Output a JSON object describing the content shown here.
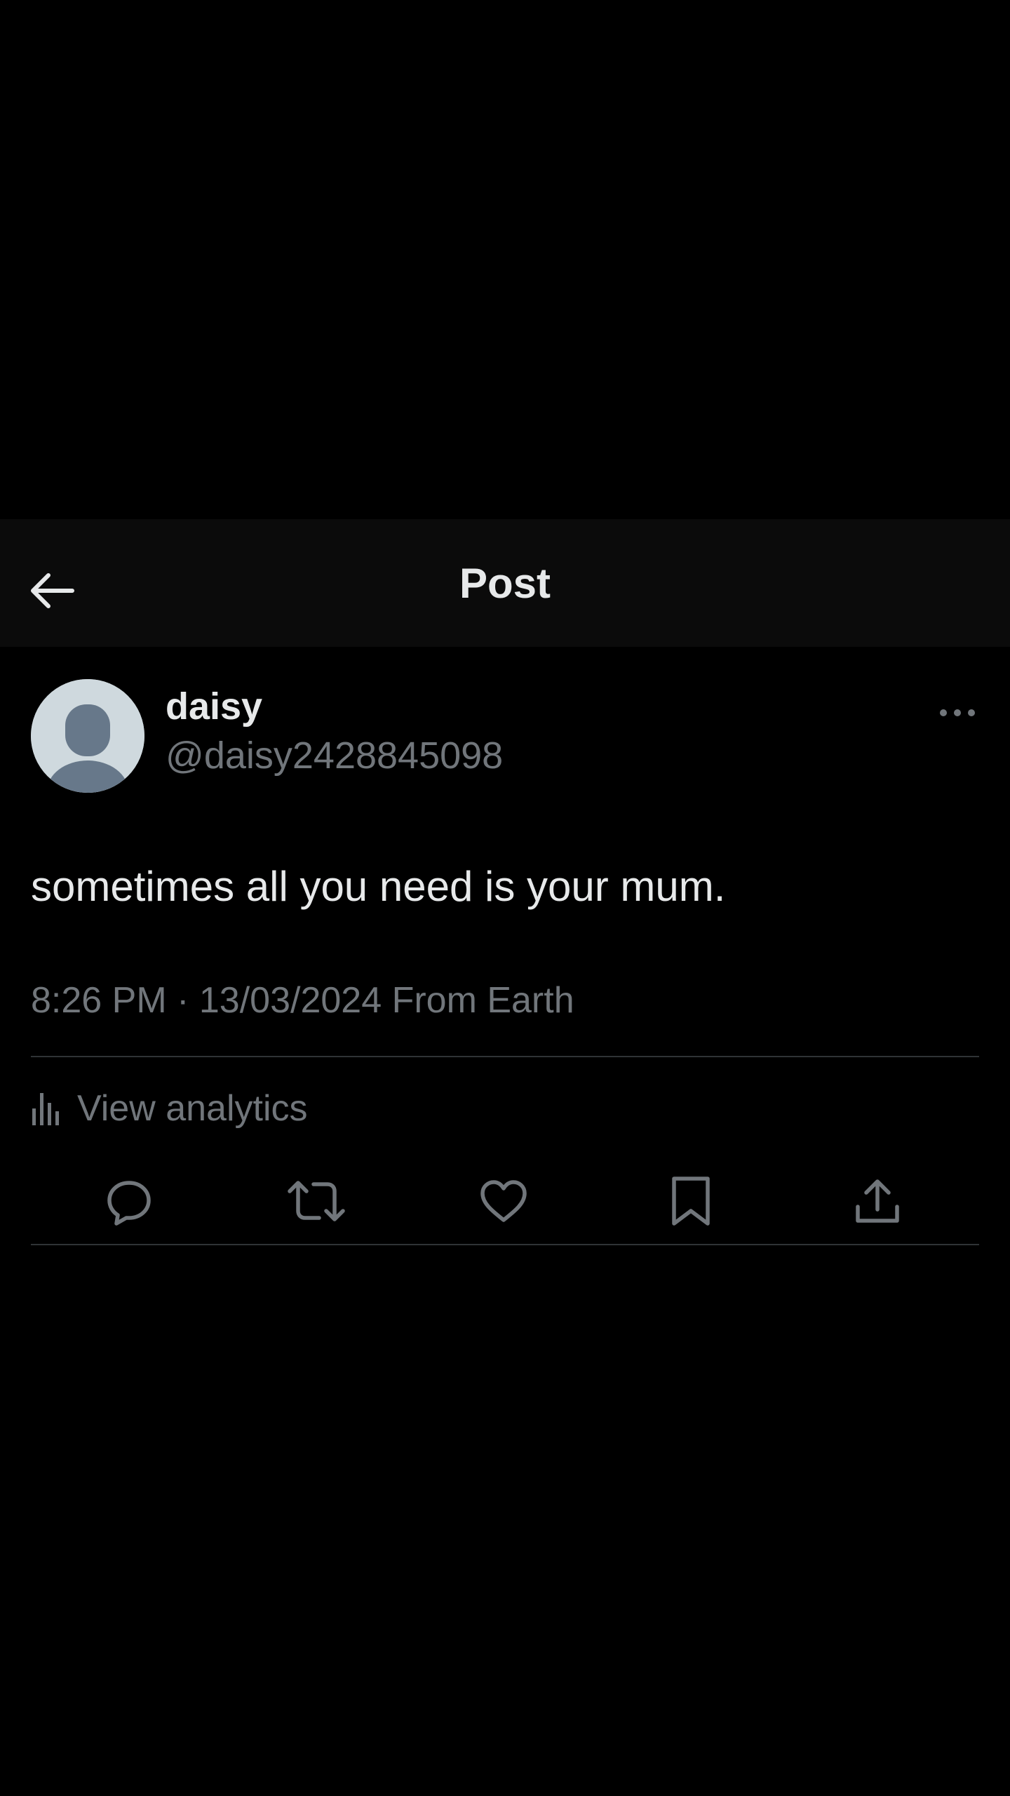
{
  "header": {
    "title": "Post",
    "back_icon": "arrow-left-icon"
  },
  "post": {
    "author": {
      "display_name": "daisy",
      "handle": "@daisy2428845098",
      "avatar": "default-avatar-icon"
    },
    "more_icon": "more-horizontal-icon",
    "text": "sometimes all you need is your mum.",
    "meta": "8:26 PM · 13/03/2024 From Earth",
    "analytics": {
      "label": "View analytics",
      "icon": "analytics-icon"
    },
    "actions": [
      {
        "name": "reply",
        "icon": "reply-icon"
      },
      {
        "name": "repost",
        "icon": "repost-icon"
      },
      {
        "name": "like",
        "icon": "heart-icon"
      },
      {
        "name": "bookmark",
        "icon": "bookmark-icon"
      },
      {
        "name": "share",
        "icon": "share-icon"
      }
    ]
  },
  "colors": {
    "background": "#000000",
    "header_background": "#0b0b0b",
    "primary_text": "#e7e9ea",
    "secondary_text": "#71767b",
    "divider": "#2f3336"
  }
}
